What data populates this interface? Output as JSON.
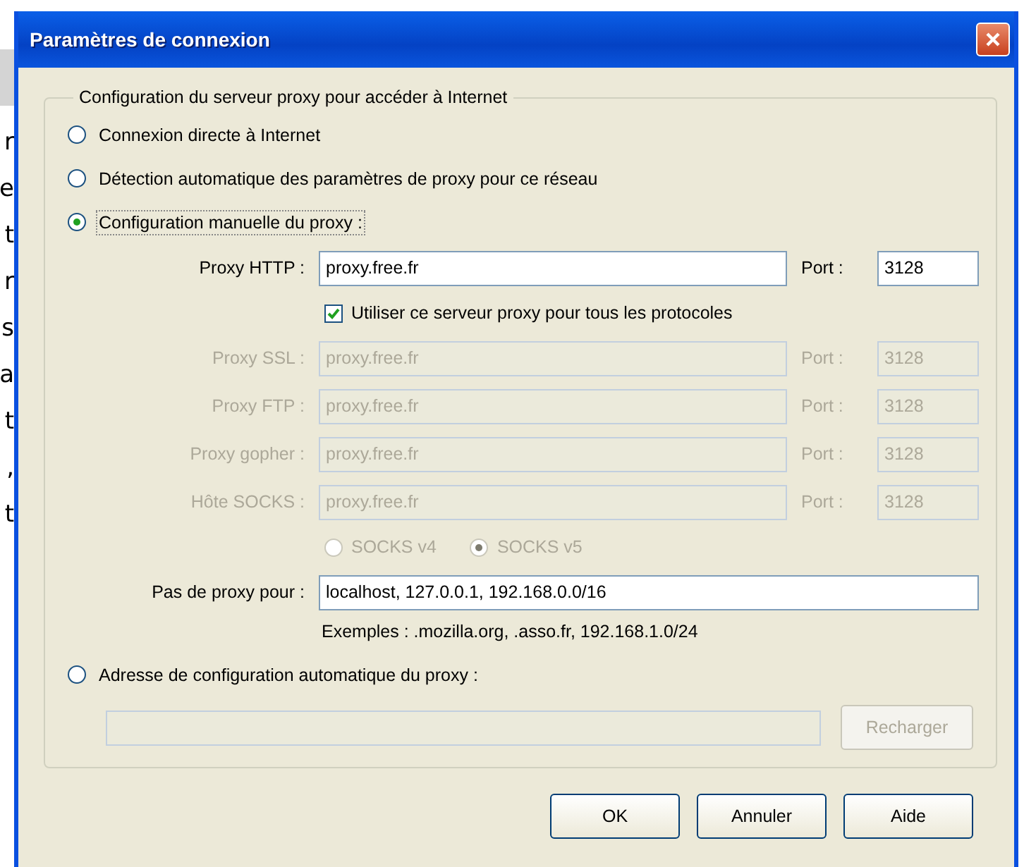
{
  "background_text": [
    "r",
    "e",
    "t",
    "r",
    "s",
    "a",
    "t",
    ",",
    "t"
  ],
  "window": {
    "title": "Paramètres de connexion"
  },
  "group": {
    "title": "Configuration du serveur proxy pour accéder à Internet",
    "options": [
      {
        "kind": "direct",
        "label": "Connexion directe à Internet",
        "selected": false
      },
      {
        "kind": "auto_detect",
        "label": "Détection automatique des paramètres de proxy pour ce réseau",
        "selected": false
      },
      {
        "kind": "manual",
        "label": "Configuration manuelle du proxy :",
        "selected": true
      },
      {
        "kind": "auto_config",
        "label": "Adresse de configuration automatique du proxy :",
        "selected": false
      }
    ]
  },
  "manual": {
    "proxies": [
      {
        "label": "Proxy HTTP :",
        "value": "proxy.free.fr",
        "port_label": "Port :",
        "port": "3128",
        "disabled": false
      },
      {
        "label": "Proxy SSL :",
        "value": "proxy.free.fr",
        "port_label": "Port :",
        "port": "3128",
        "disabled": true
      },
      {
        "label": "Proxy FTP :",
        "value": "proxy.free.fr",
        "port_label": "Port :",
        "port": "3128",
        "disabled": true
      },
      {
        "label": "Proxy gopher :",
        "value": "proxy.free.fr",
        "port_label": "Port :",
        "port": "3128",
        "disabled": true
      },
      {
        "label": "Hôte SOCKS :",
        "value": "proxy.free.fr",
        "port_label": "Port :",
        "port": "3128",
        "disabled": true
      }
    ],
    "share_all": {
      "label": "Utiliser ce serveur proxy pour tous les protocoles",
      "checked": true
    },
    "socks_versions": [
      {
        "label": "SOCKS v4",
        "selected": false,
        "disabled": true
      },
      {
        "label": "SOCKS v5",
        "selected": true,
        "disabled": true
      }
    ],
    "no_proxy": {
      "label": "Pas de proxy pour :",
      "value": "localhost, 127.0.0.1, 192.168.0.0/16"
    },
    "examples": "Exemples : .mozilla.org, .asso.fr, 192.168.1.0/24"
  },
  "auto_config": {
    "disabled": true,
    "reload_button": {
      "label": "Recharger",
      "disabled": true
    }
  },
  "buttons": [
    {
      "label": "OK"
    },
    {
      "label": "Annuler"
    },
    {
      "label": "Aide"
    }
  ]
}
